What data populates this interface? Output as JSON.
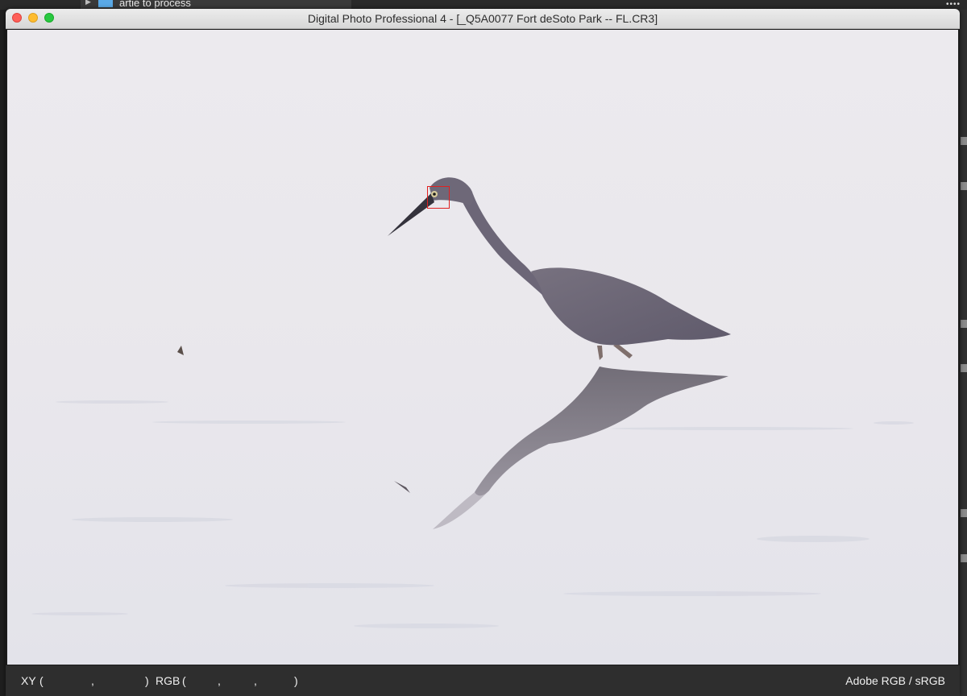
{
  "background_app": {
    "folder_label": "artie to process",
    "dots": "••••"
  },
  "window": {
    "title": "Digital Photo Professional 4 - [_Q5A0077 Fort deSoto Park -- FL.CR3]"
  },
  "status_bar": {
    "xy_label": "XY",
    "open_paren": "(",
    "close_paren": ")",
    "comma": ",",
    "rgb_label": "RGB",
    "color_space": "Adobe RGB / sRGB"
  },
  "colors": {
    "close": "#fe5f57",
    "minimize": "#febc2e",
    "maximize": "#28c840",
    "af_point": "#e02020",
    "water": "#ebe8ec",
    "heron": "#6b6679"
  },
  "icons": {
    "close": "close-icon",
    "minimize": "minimize-icon",
    "maximize": "maximize-icon",
    "folder": "folder-icon",
    "disclosure": "disclosure-triangle-icon"
  }
}
